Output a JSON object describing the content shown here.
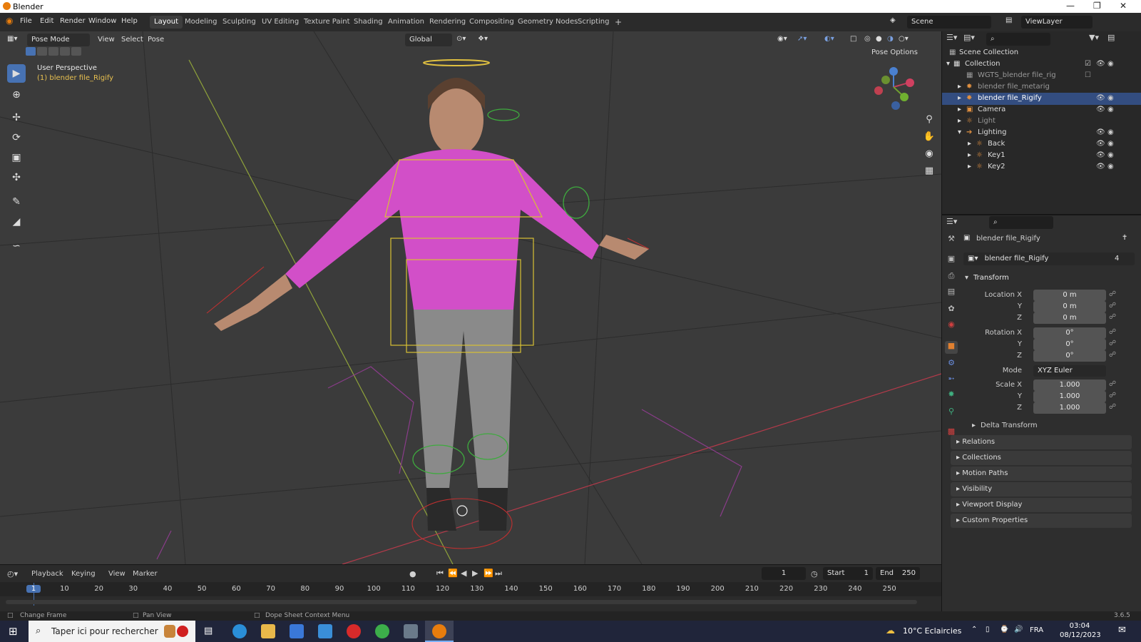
{
  "window": {
    "title": "Blender"
  },
  "menus": [
    "File",
    "Edit",
    "Render",
    "Window",
    "Help"
  ],
  "workspaces": [
    "Layout",
    "Modeling",
    "Sculpting",
    "UV Editing",
    "Texture Paint",
    "Shading",
    "Animation",
    "Rendering",
    "Compositing",
    "Geometry Nodes",
    "Scripting"
  ],
  "workspace_active": "Layout",
  "scene": "Scene",
  "viewlayer": "ViewLayer",
  "viewport": {
    "mode": "Pose Mode",
    "menus": [
      "View",
      "Select",
      "Pose"
    ],
    "orientation": "Global",
    "pose_options": "Pose Options",
    "overlay_title": "User Perspective",
    "overlay_object": "(1) blender file_Rigify"
  },
  "outliner": {
    "rows": [
      {
        "name": "Scene Collection"
      },
      {
        "name": "Collection"
      },
      {
        "name": "WGTS_blender file_rig"
      },
      {
        "name": "blender file_metarig"
      },
      {
        "name": "blender file_Rigify"
      },
      {
        "name": "Camera"
      },
      {
        "name": "Light"
      },
      {
        "name": "Lighting"
      },
      {
        "name": "Back"
      },
      {
        "name": "Key1"
      },
      {
        "name": "Key2"
      }
    ]
  },
  "properties": {
    "object_name": "blender file_Rigify",
    "datablock": "blender file_Rigify",
    "users": "4",
    "transform_label": "Transform",
    "location_label": "Location X",
    "rotation_label": "Rotation X",
    "scale_label": "Scale X",
    "axis_y": "Y",
    "axis_z": "Z",
    "location": [
      "0 m",
      "0 m",
      "0 m"
    ],
    "rotation": [
      "0°",
      "0°",
      "0°"
    ],
    "mode_label": "Mode",
    "mode": "XYZ Euler",
    "scale": [
      "1.000",
      "1.000",
      "1.000"
    ],
    "panels": [
      "Delta Transform",
      "Relations",
      "Collections",
      "Motion Paths",
      "Visibility",
      "Viewport Display",
      "Custom Properties"
    ]
  },
  "timeline": {
    "menus": [
      "Playback",
      "Keying",
      "View",
      "Marker"
    ],
    "current_frame": "1",
    "start_label": "Start",
    "start": "1",
    "end_label": "End",
    "end": "250",
    "ticks": [
      "1",
      "10",
      "20",
      "30",
      "40",
      "50",
      "60",
      "70",
      "80",
      "90",
      "100",
      "110",
      "120",
      "130",
      "140",
      "150",
      "160",
      "170",
      "180",
      "190",
      "200",
      "210",
      "220",
      "230",
      "240",
      "250"
    ]
  },
  "status": {
    "left": "Change Frame",
    "mid": "Pan View",
    "right": "Dope Sheet Context Menu",
    "version": "3.6.5"
  },
  "taskbar": {
    "search": "Taper ici pour rechercher",
    "weather": "10°C  Eclaircies",
    "lang": "FRA",
    "time": "03:04",
    "date": "08/12/2023"
  },
  "colors": {
    "accent": "#4772b3",
    "selection": "#334d80",
    "playhead": "#4772b3"
  }
}
